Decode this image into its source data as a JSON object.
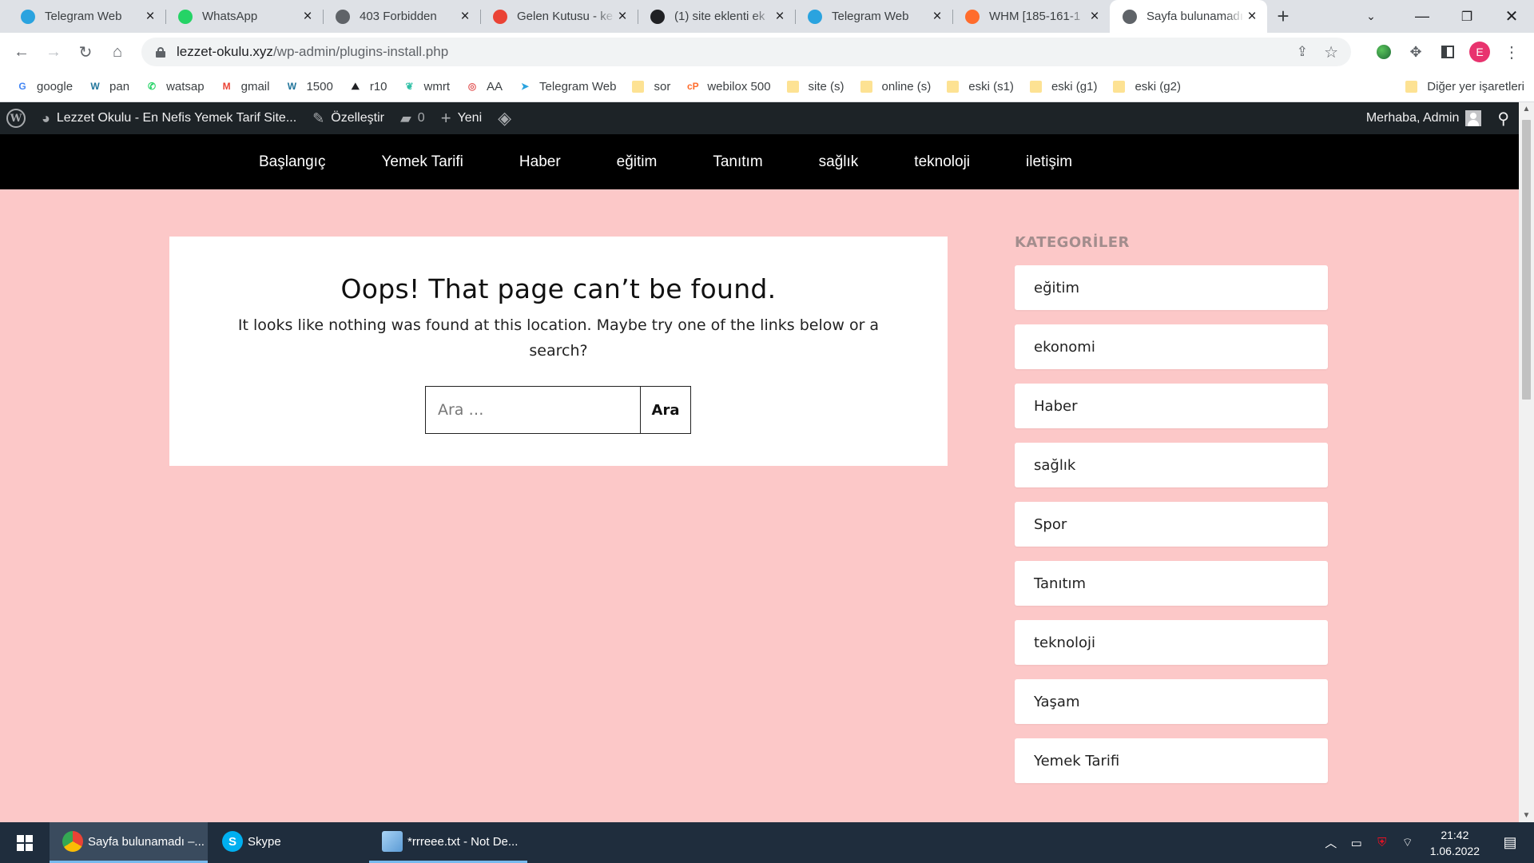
{
  "browser": {
    "tabs": [
      {
        "title": "Telegram Web",
        "icon": "telegram-icon",
        "color": "#2aa3df",
        "active": false
      },
      {
        "title": "WhatsApp",
        "icon": "whatsapp-icon",
        "color": "#25d366",
        "active": false
      },
      {
        "title": "403 Forbidden",
        "icon": "globe-icon",
        "color": "#5f6368",
        "active": false
      },
      {
        "title": "Gelen Kutusu - ke",
        "icon": "gmail-icon",
        "color": "#ea4335",
        "active": false
      },
      {
        "title": "(1) site eklenti ek",
        "icon": "r10-icon",
        "color": "#202124",
        "active": false
      },
      {
        "title": "Telegram Web",
        "icon": "telegram-icon",
        "color": "#2aa3df",
        "active": false
      },
      {
        "title": "WHM [185-161-1",
        "icon": "cpanel-icon",
        "color": "#ff6c2c",
        "active": false
      },
      {
        "title": "Sayfa bulunamadı",
        "icon": "globe-icon",
        "color": "#5f6368",
        "active": true
      }
    ],
    "url_host": "lezzet-okulu.xyz",
    "url_path": "/wp-admin/plugins-install.php",
    "profile_initial": "E",
    "profile_color": "#e8336e",
    "bookmarks": [
      {
        "label": "google",
        "icon": "google-icon",
        "color": "#4285f4",
        "glyph": "G"
      },
      {
        "label": "pan",
        "icon": "wordpress-icon",
        "color": "#21759b",
        "glyph": "W"
      },
      {
        "label": "watsap",
        "icon": "whatsapp-icon",
        "color": "#25d366",
        "glyph": "✆"
      },
      {
        "label": "gmail",
        "icon": "gmail-icon",
        "color": "#ea4335",
        "glyph": "M"
      },
      {
        "label": "1500",
        "icon": "wordpress-icon",
        "color": "#21759b",
        "glyph": "W"
      },
      {
        "label": "r10",
        "icon": "r10-icon",
        "color": "#202124",
        "glyph": "⛰"
      },
      {
        "label": "wmrt",
        "icon": "wmrt-icon",
        "color": "#2ebfa5",
        "glyph": "❦"
      },
      {
        "label": "AA",
        "icon": "aa-icon",
        "color": "#e35b5b",
        "glyph": "◎"
      },
      {
        "label": "Telegram Web",
        "icon": "telegram-icon",
        "color": "#2aa3df",
        "glyph": "➤"
      },
      {
        "label": "sor",
        "icon": "folder-icon",
        "folder": true
      },
      {
        "label": "webilox 500",
        "icon": "cpanel-icon",
        "color": "#ff6c2c",
        "glyph": "cP"
      },
      {
        "label": "site (s)",
        "icon": "folder-icon",
        "folder": true
      },
      {
        "label": "online (s)",
        "icon": "folder-icon",
        "folder": true
      },
      {
        "label": "eski (s1)",
        "icon": "folder-icon",
        "folder": true
      },
      {
        "label": "eski (g1)",
        "icon": "folder-icon",
        "folder": true
      },
      {
        "label": "eski (g2)",
        "icon": "folder-icon",
        "folder": true
      }
    ],
    "other_bookmarks": "Diğer yer işaretleri"
  },
  "adminbar": {
    "site_name": "Lezzet Okulu - En Nefis Yemek Tarif Site...",
    "customize": "Özelleştir",
    "comments_count": "0",
    "new_label": "Yeni",
    "greeting": "Merhaba, Admin"
  },
  "nav": {
    "items": [
      "Başlangıç",
      "Yemek Tarifi",
      "Haber",
      "eğitim",
      "Tanıtım",
      "sağlık",
      "teknoloji",
      "iletişim"
    ]
  },
  "notfound": {
    "title": "Oops! That page can’t be found.",
    "message": "It looks like nothing was found at this location. Maybe try one of the links below or a search?",
    "search_placeholder": "Ara …",
    "search_button": "Ara"
  },
  "sidebar": {
    "heading": "KATEGORİLER",
    "categories": [
      "eğitim",
      "ekonomi",
      "Haber",
      "sağlık",
      "Spor",
      "Tanıtım",
      "teknoloji",
      "Yaşam",
      "Yemek Tarifi"
    ]
  },
  "taskbar": {
    "tasks": [
      {
        "label": "Sayfa bulunamadı –...",
        "icon": "chrome-icon",
        "state": "active"
      },
      {
        "label": "Skype",
        "icon": "skype-icon",
        "state": "normal"
      },
      {
        "label": "*rrreee.txt - Not De...",
        "icon": "notepad-icon",
        "state": "open"
      }
    ],
    "time": "21:42",
    "date": "1.06.2022"
  },
  "colors": {
    "page_background": "#fcc8c8",
    "admin_bar": "#1d2327",
    "nav_bar": "#000000",
    "taskbar": "#1f2d3d"
  }
}
